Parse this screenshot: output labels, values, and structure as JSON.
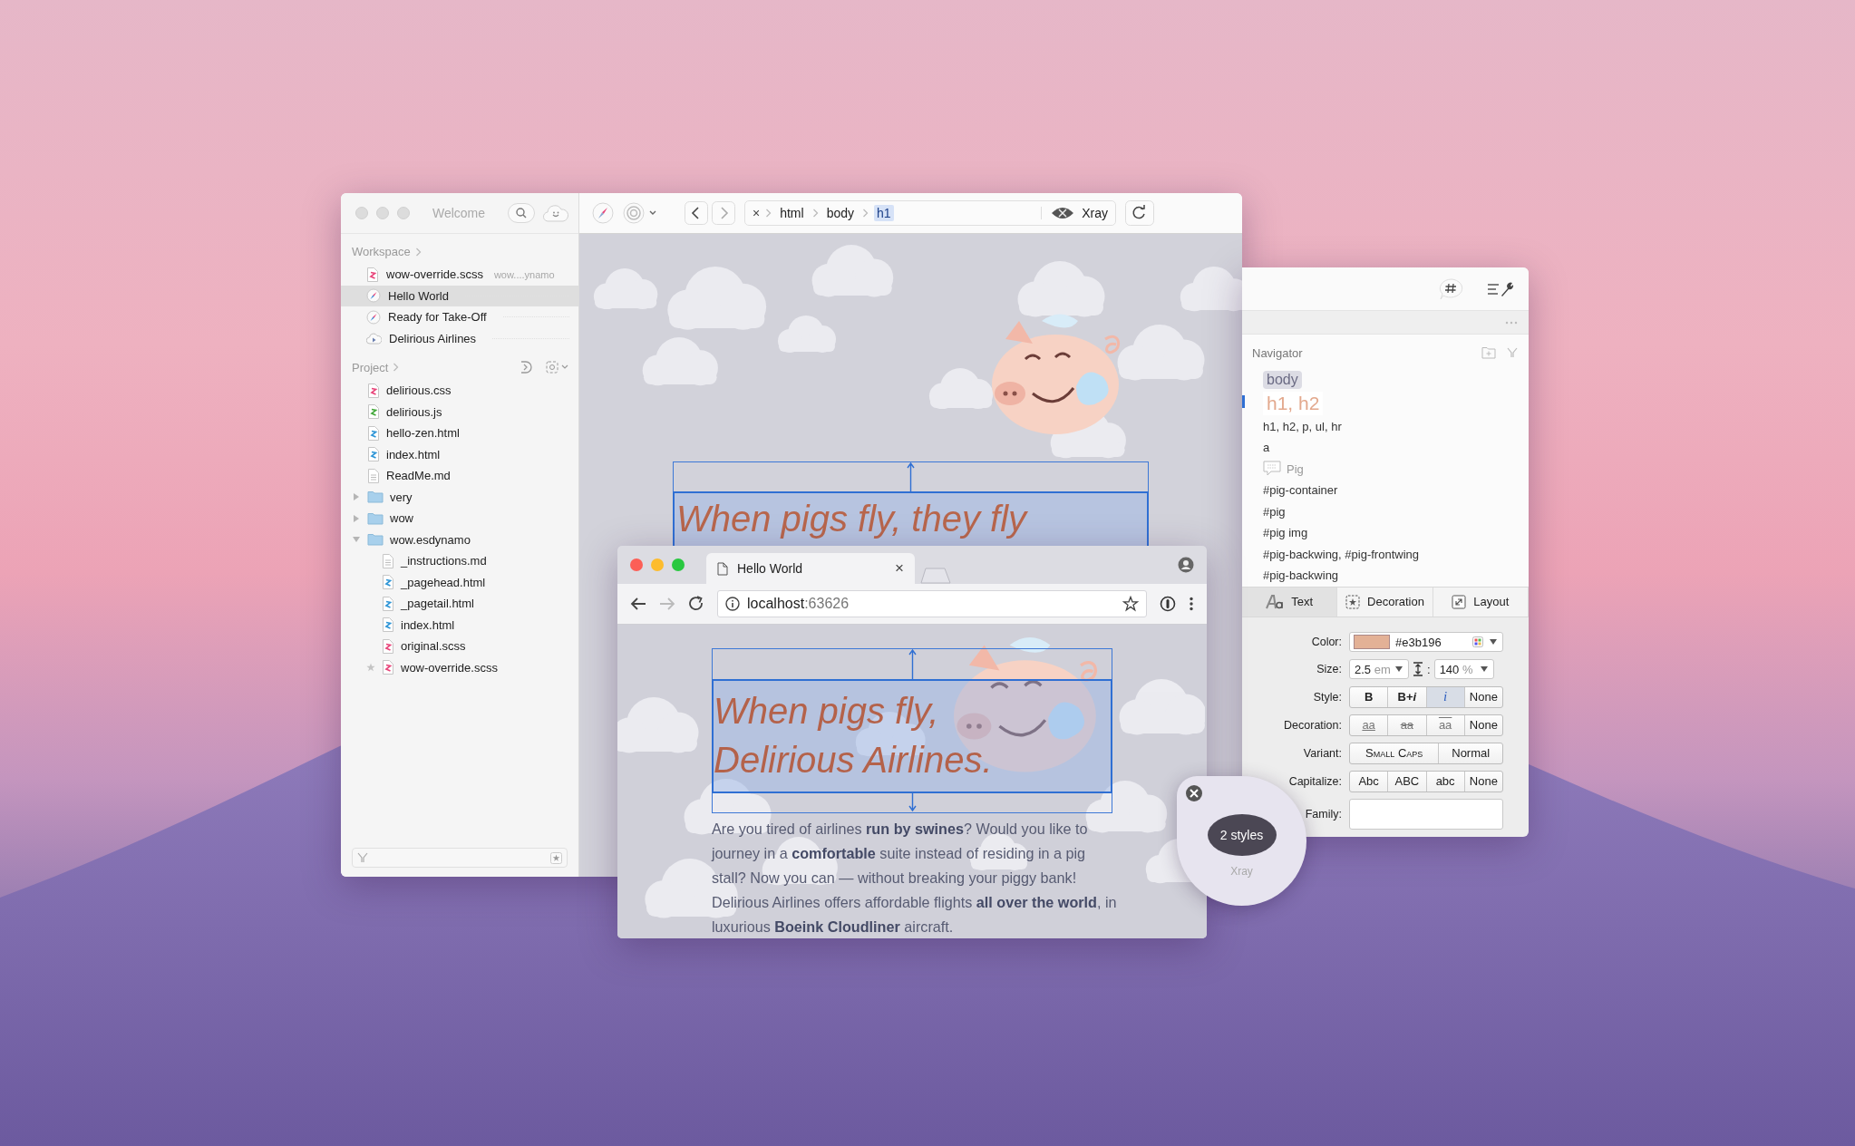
{
  "editor": {
    "title": "Welcome",
    "workspace": {
      "heading": "Workspace",
      "items": [
        {
          "name": "wow-override.scss",
          "detail": "wow....ynamo",
          "kind": "style",
          "selected": false
        },
        {
          "name": "Hello World",
          "kind": "compass",
          "selected": true
        },
        {
          "name": "Ready for Take-Off",
          "kind": "compass",
          "selected": false
        },
        {
          "name": "Delirious Airlines",
          "kind": "cloud",
          "selected": false
        }
      ]
    },
    "project": {
      "heading": "Project",
      "items": [
        {
          "name": "delirious.css",
          "kind": "style"
        },
        {
          "name": "delirious.js",
          "kind": "script"
        },
        {
          "name": "hello-zen.html",
          "kind": "html"
        },
        {
          "name": "index.html",
          "kind": "html"
        },
        {
          "name": "ReadMe.md",
          "kind": "text"
        },
        {
          "name": "very",
          "kind": "folder",
          "expanded": false
        },
        {
          "name": "wow",
          "kind": "folder",
          "expanded": false
        },
        {
          "name": "wow.esdynamo",
          "kind": "folder",
          "expanded": true,
          "children": [
            {
              "name": "_instructions.md",
              "kind": "text",
              "starred": false
            },
            {
              "name": "_pagehead.html",
              "kind": "html",
              "starred": false
            },
            {
              "name": "_pagetail.html",
              "kind": "html",
              "starred": false
            },
            {
              "name": "index.html",
              "kind": "html",
              "starred": false
            },
            {
              "name": "original.scss",
              "kind": "style",
              "starred": false
            },
            {
              "name": "wow-override.scss",
              "kind": "style",
              "starred": true
            }
          ]
        }
      ]
    },
    "toolbar": {
      "clear": "×",
      "crumbs": [
        {
          "label": "html",
          "selected": false
        },
        {
          "label": "body",
          "selected": false
        },
        {
          "label": "h1",
          "selected": true
        }
      ],
      "xray": "Xray"
    },
    "preview": {
      "heading": "When pigs fly, they fly"
    }
  },
  "inspector": {
    "navigator": {
      "heading": "Navigator",
      "items": [
        {
          "label": "body",
          "kind": "parent"
        },
        {
          "label": "h1, h2",
          "kind": "current"
        },
        {
          "label": "h1, h2, p, ul, hr",
          "kind": "rule"
        },
        {
          "label": "a",
          "kind": "rule"
        },
        {
          "label": "Pig",
          "kind": "comment"
        },
        {
          "label": "#pig-container",
          "kind": "rule"
        },
        {
          "label": "#pig",
          "kind": "rule"
        },
        {
          "label": "#pig img",
          "kind": "rule"
        },
        {
          "label": "#pig-backwing, #pig-frontwing",
          "kind": "rule"
        },
        {
          "label": "#pig-backwing",
          "kind": "rule"
        }
      ]
    },
    "tabs": [
      {
        "label": "Text",
        "kind": "text",
        "selected": true
      },
      {
        "label": "Decoration",
        "kind": "decoration",
        "selected": false
      },
      {
        "label": "Layout",
        "kind": "layout",
        "selected": false
      }
    ],
    "rows": [
      {
        "kind": "color",
        "label": "Color:",
        "color": "#e3b196",
        "value": "#e3b196"
      },
      {
        "kind": "size",
        "label": "Size:",
        "value": "2.5",
        "unit": "em",
        "line_sep": ":",
        "line_value": "140",
        "line_unit": "%"
      },
      {
        "kind": "segments",
        "label": "Style:",
        "options": [
          {
            "label": "B",
            "kind": "bold",
            "selected": false
          },
          {
            "label": "B+*i*",
            "kind": "bold-italic",
            "selected": false
          },
          {
            "label": "i",
            "kind": "italic",
            "selected": true
          },
          {
            "label": "None",
            "kind": "none",
            "selected": false
          }
        ]
      },
      {
        "kind": "segments",
        "label": "Decoration:",
        "options": [
          {
            "label": "aa",
            "kind": "underline"
          },
          {
            "label": "aa",
            "kind": "strike"
          },
          {
            "label": "aa",
            "kind": "overline"
          },
          {
            "label": "None",
            "kind": "none"
          }
        ]
      },
      {
        "kind": "segments",
        "label": "Variant:",
        "options": [
          {
            "label": "Small Caps",
            "kind": "small-caps"
          },
          {
            "label": "Normal",
            "kind": "none"
          }
        ]
      },
      {
        "kind": "segments",
        "label": "Capitalize:",
        "options": [
          {
            "label": "Abc",
            "kind": "none"
          },
          {
            "label": "ABC",
            "kind": "none"
          },
          {
            "label": "abc",
            "kind": "none"
          },
          {
            "label": "None",
            "kind": "none"
          }
        ]
      },
      {
        "kind": "field",
        "label": "Family:"
      }
    ]
  },
  "browser": {
    "tab": {
      "title": "Hello World",
      "close": "×"
    },
    "url": {
      "host": "localhost",
      "port": ":63626"
    },
    "heading": [
      "When pigs fly,",
      "Delirious Airlines."
    ],
    "paragraph": "Are you tired of airlines **run by swines**? Would you like to journey in a **comfortable** suite instead of residing in a pig stall? Now you can — without breaking your piggy bank! Delirious Airlines offers affordable flights **all over the world**, in luxurious **Boeink Cloudliner** aircraft."
  },
  "xray": {
    "count": "2 styles",
    "label": "Xray"
  }
}
